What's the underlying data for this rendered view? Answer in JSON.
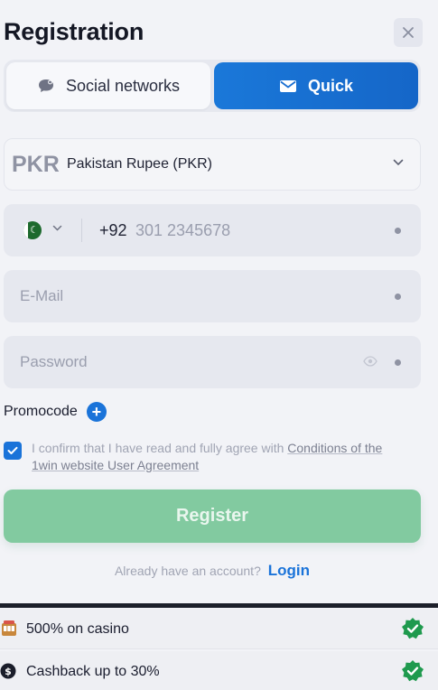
{
  "header": {
    "title": "Registration"
  },
  "tabs": [
    {
      "label": "Social networks",
      "icon": "chat-bubble-icon",
      "active": false
    },
    {
      "label": "Quick",
      "icon": "envelope-icon",
      "active": true
    }
  ],
  "currency": {
    "code": "PKR",
    "name": "Pakistan Rupee (PKR)"
  },
  "phone": {
    "country_code": "+92",
    "placeholder": "301 2345678",
    "value": ""
  },
  "email": {
    "placeholder": "E-Mail",
    "value": ""
  },
  "password": {
    "placeholder": "Password",
    "value": ""
  },
  "promocode": {
    "label": "Promocode",
    "add_symbol": "+"
  },
  "agreement": {
    "checked": true,
    "text": "I confirm that I have read and fully agree with ",
    "link": "Conditions of the 1win website User Agreement"
  },
  "register_button": {
    "label": "Register"
  },
  "login": {
    "prompt": "Already have an account?",
    "link": "Login"
  },
  "bonuses": [
    {
      "label": "500% on casino",
      "icon": "casino-icon"
    },
    {
      "label": "Cashback up to 30%",
      "icon": "cashback-icon"
    }
  ],
  "colors": {
    "accent_blue": "#1a73d9",
    "register_green": "#82caa0",
    "badge_green": "#1f9a4e",
    "background": "#f2f3f7"
  }
}
